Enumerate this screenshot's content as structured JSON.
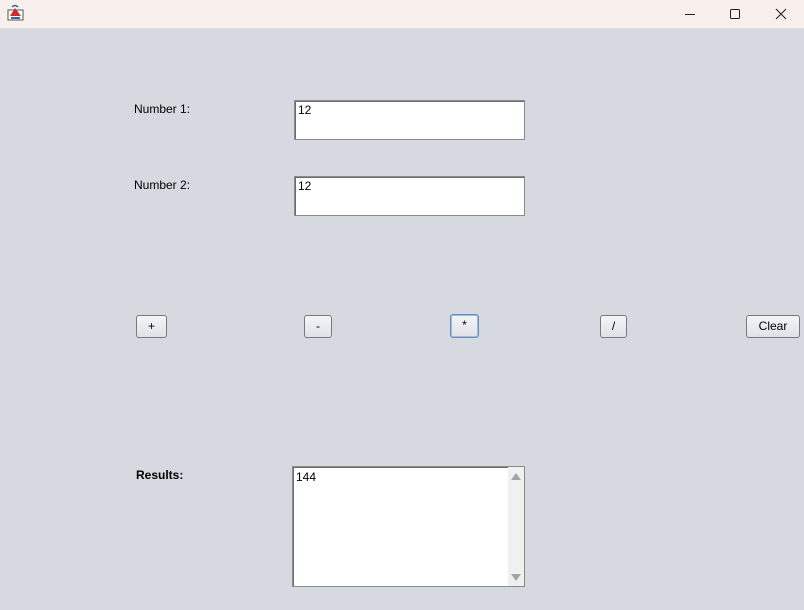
{
  "window": {
    "title": "",
    "controls": {
      "minimize_icon": "minimize-icon",
      "maximize_icon": "maximize-icon",
      "close_icon": "close-icon"
    }
  },
  "form": {
    "number1_label": "Number 1:",
    "number1_value": "12",
    "number2_label": "Number 2:",
    "number2_value": "12"
  },
  "operations": {
    "add_label": "+",
    "subtract_label": "-",
    "multiply_label": "*",
    "divide_label": "/",
    "clear_label": "Clear"
  },
  "results": {
    "label": "Results:",
    "value": "144"
  },
  "colors": {
    "background": "#d6d9e0",
    "titlebar": "#f8f0ec",
    "focus_border": "#6b8fbd"
  }
}
